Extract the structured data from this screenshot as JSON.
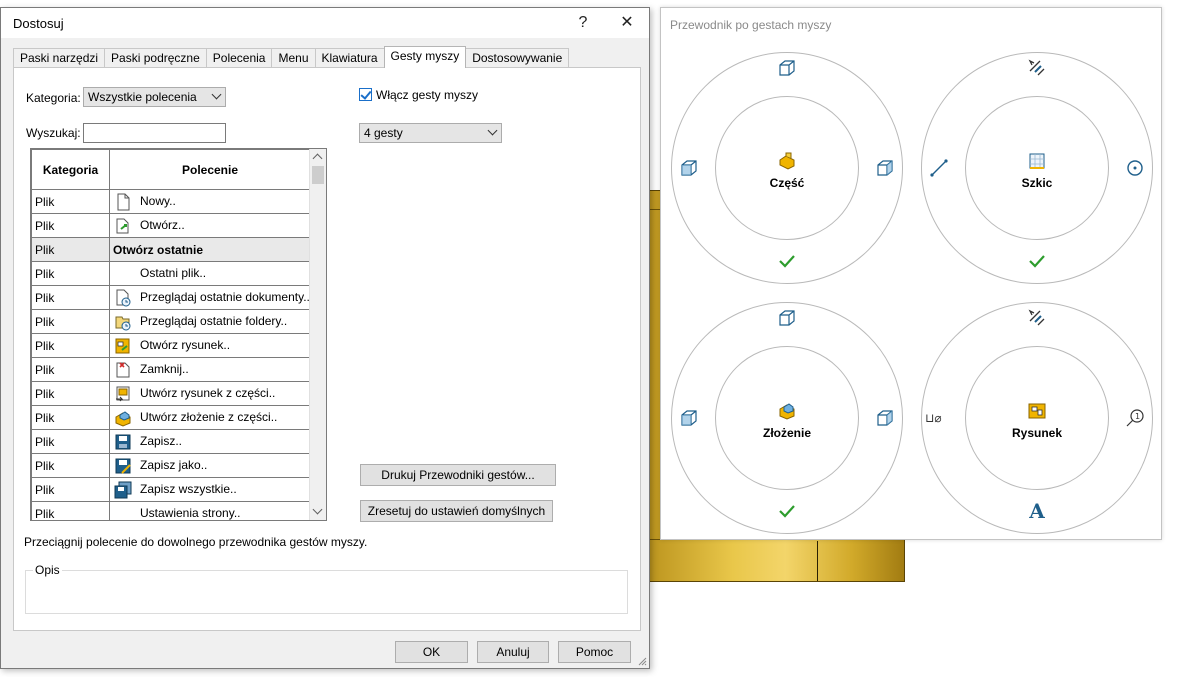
{
  "dialog": {
    "title": "Dostosuj",
    "help_glyph": "?",
    "close_glyph": "✕",
    "tabs": [
      {
        "label": "Paski narzędzi"
      },
      {
        "label": "Paski podręczne"
      },
      {
        "label": "Polecenia"
      },
      {
        "label": "Menu"
      },
      {
        "label": "Klawiatura"
      },
      {
        "label": "Gesty myszy",
        "active": true
      },
      {
        "label": "Dostosowywanie"
      }
    ],
    "category_label": "Kategoria:",
    "category_value": "Wszystkie polecenia",
    "search_label": "Wyszukaj:",
    "search_value": "",
    "enable_gestures_label": "Włącz gesty myszy",
    "enable_gestures_checked": true,
    "gesture_count_value": "4 gesty",
    "table": {
      "headers": [
        "Kategoria",
        "Polecenie"
      ],
      "rows": [
        {
          "cat": "Plik",
          "cmd": "Nowy..",
          "icon": "new-document-icon"
        },
        {
          "cat": "Plik",
          "cmd": "Otwórz..",
          "icon": "open-document-icon"
        },
        {
          "cat": "Plik",
          "cmd": "Otwórz ostatnie",
          "icon": "",
          "group": true
        },
        {
          "cat": "Plik",
          "cmd": "Ostatni plik..",
          "icon": ""
        },
        {
          "cat": "Plik",
          "cmd": "Przeglądaj ostatnie dokumenty..",
          "icon": "recent-documents-icon"
        },
        {
          "cat": "Plik",
          "cmd": "Przeglądaj ostatnie foldery..",
          "icon": "recent-folders-icon"
        },
        {
          "cat": "Plik",
          "cmd": "Otwórz rysunek..",
          "icon": "open-drawing-icon"
        },
        {
          "cat": "Plik",
          "cmd": "Zamknij..",
          "icon": "close-document-icon"
        },
        {
          "cat": "Plik",
          "cmd": "Utwórz rysunek z części..",
          "icon": "make-drawing-icon"
        },
        {
          "cat": "Plik",
          "cmd": "Utwórz złożenie z części..",
          "icon": "make-assembly-icon"
        },
        {
          "cat": "Plik",
          "cmd": "Zapisz..",
          "icon": "save-icon"
        },
        {
          "cat": "Plik",
          "cmd": "Zapisz jako..",
          "icon": "save-as-icon"
        },
        {
          "cat": "Plik",
          "cmd": "Zapisz wszystkie..",
          "icon": "save-all-icon"
        },
        {
          "cat": "Plik",
          "cmd": "Ustawienia strony..",
          "icon": ""
        }
      ]
    },
    "print_guides_label": "Drukuj Przewodniki gestów...",
    "reset_label": "Zresetuj do ustawień domyślnych",
    "hint": "Przeciągnij polecenie do dowolnego przewodnika gestów myszy.",
    "description_legend": "Opis",
    "ok_label": "OK",
    "cancel_label": "Anuluj",
    "help_label": "Pomoc"
  },
  "guide": {
    "title": "Przewodnik po gestach myszy",
    "wheels": [
      {
        "label": "Część",
        "center_icon": "part-icon",
        "top": "view-cube-icon",
        "left": "view-left-icon",
        "right": "view-right-icon",
        "bottom": "checkmark-icon"
      },
      {
        "label": "Szkic",
        "center_icon": "sketch-icon",
        "top": "smart-dimension-icon",
        "left": "line-icon",
        "right": "circle-icon",
        "bottom": "checkmark-icon"
      },
      {
        "label": "Złożenie",
        "center_icon": "assembly-icon",
        "top": "view-cube-icon",
        "left": "view-left-icon",
        "right": "view-right-icon",
        "bottom": "checkmark-icon"
      },
      {
        "label": "Rysunek",
        "center_icon": "drawing-icon",
        "top": "smart-dimension-icon",
        "left": "hole-callout-icon",
        "right": "balloon-icon",
        "bottom": "note-icon"
      }
    ],
    "hole_callout_text": "⊔⌀",
    "note_glyph": "A"
  },
  "colors": {
    "checkmark": "#2e9d2e",
    "icon_blue": "#1f5f8b",
    "part_yellow": "#f0b400"
  }
}
